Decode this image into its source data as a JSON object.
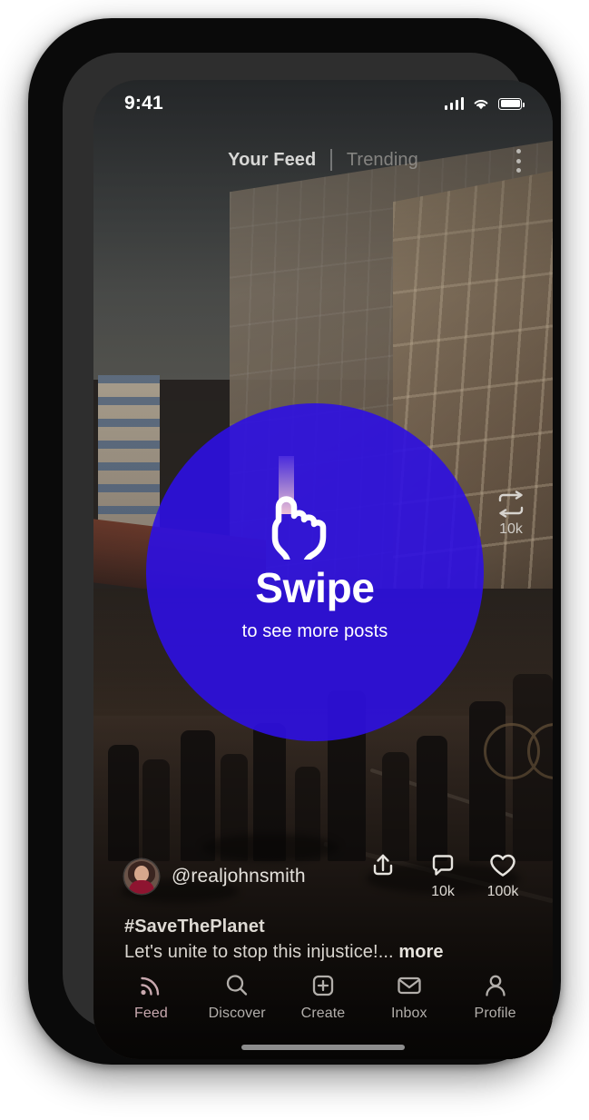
{
  "status_bar": {
    "time": "9:41",
    "signal_icon": "cellular-signal-icon",
    "wifi_icon": "wifi-icon",
    "battery_icon": "battery-full-icon"
  },
  "top_bar": {
    "tabs": [
      {
        "label": "Your Feed",
        "active": true
      },
      {
        "label": "Trending",
        "active": false
      }
    ],
    "overflow_icon": "kebab-menu-icon"
  },
  "right_rail": {
    "repost": {
      "icon": "repost-icon",
      "count": "10k"
    }
  },
  "swipe_overlay": {
    "title": "Swipe",
    "subtitle": "to see more posts",
    "hand_icon": "swipe-hand-icon",
    "circle_color": "#2E10E2",
    "trail_colors": [
      "#4a2bdd",
      "#8f6fd4",
      "#e8b6cf"
    ]
  },
  "post": {
    "avatar": "user-avatar",
    "handle": "@realjohnsmith",
    "hashtag": "#SaveThePlanet",
    "caption_text": "Let's unite to stop this injustice!...",
    "caption_more": "more",
    "actions": [
      {
        "name": "share",
        "icon": "share-icon",
        "count": ""
      },
      {
        "name": "comment",
        "icon": "comment-icon",
        "count": "10k"
      },
      {
        "name": "like",
        "icon": "heart-icon",
        "count": "100k"
      }
    ]
  },
  "bottom_nav": {
    "active_color": "#C9A9AF",
    "items": [
      {
        "label": "Feed",
        "icon": "rss-feed-icon",
        "active": true
      },
      {
        "label": "Discover",
        "icon": "search-icon",
        "active": false
      },
      {
        "label": "Create",
        "icon": "plus-square-icon",
        "active": false
      },
      {
        "label": "Inbox",
        "icon": "envelope-icon",
        "active": false
      },
      {
        "label": "Profile",
        "icon": "person-icon",
        "active": false
      }
    ]
  }
}
